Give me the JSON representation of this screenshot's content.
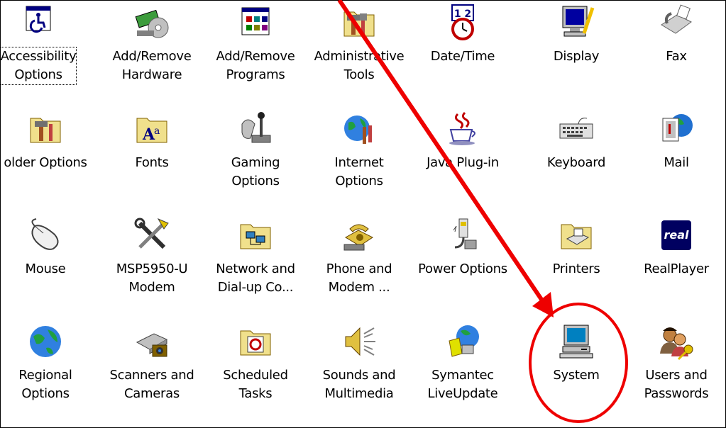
{
  "control_panel": {
    "items": [
      {
        "label": "Accessibility\nOptions",
        "icon": "accessibility-icon"
      },
      {
        "label": "Add/Remove\nHardware",
        "icon": "hardware-icon"
      },
      {
        "label": "Add/Remove\nPrograms",
        "icon": "programs-icon"
      },
      {
        "label": "Administrative\nTools",
        "icon": "admin-tools-icon"
      },
      {
        "label": "Date/Time",
        "icon": "clock-icon"
      },
      {
        "label": "Display",
        "icon": "monitor-icon"
      },
      {
        "label": "Fax",
        "icon": "fax-icon"
      },
      {
        "label": "older Options",
        "icon": "folder-tools-icon"
      },
      {
        "label": "Fonts",
        "icon": "fonts-folder-icon"
      },
      {
        "label": "Gaming\nOptions",
        "icon": "joystick-icon"
      },
      {
        "label": "Internet\nOptions",
        "icon": "globe-tools-icon"
      },
      {
        "label": "Java Plug-in",
        "icon": "java-cup-icon"
      },
      {
        "label": "Keyboard",
        "icon": "keyboard-icon"
      },
      {
        "label": "Mail",
        "icon": "mail-icon"
      },
      {
        "label": "Mouse",
        "icon": "mouse-icon"
      },
      {
        "label": "MSP5950-U\nModem",
        "icon": "modem-tools-icon"
      },
      {
        "label": "Network and\nDial-up Co...",
        "icon": "network-folder-icon"
      },
      {
        "label": "Phone and\nModem ...",
        "icon": "phone-icon"
      },
      {
        "label": "Power Options",
        "icon": "power-plug-icon"
      },
      {
        "label": "Printers",
        "icon": "printer-folder-icon"
      },
      {
        "label": "RealPlayer",
        "icon": "real-icon"
      },
      {
        "label": "Regional\nOptions",
        "icon": "globe-icon"
      },
      {
        "label": "Scanners and\nCameras",
        "icon": "scanner-icon"
      },
      {
        "label": "Scheduled\nTasks",
        "icon": "tasks-folder-icon"
      },
      {
        "label": "Sounds and\nMultimedia",
        "icon": "speaker-icon"
      },
      {
        "label": "Symantec\nLiveUpdate",
        "icon": "liveupdate-icon"
      },
      {
        "label": "System",
        "icon": "computer-icon"
      },
      {
        "label": "Users and\nPasswords",
        "icon": "users-key-icon"
      }
    ]
  },
  "annotation": {
    "color": "#ee0000",
    "target": "System"
  }
}
